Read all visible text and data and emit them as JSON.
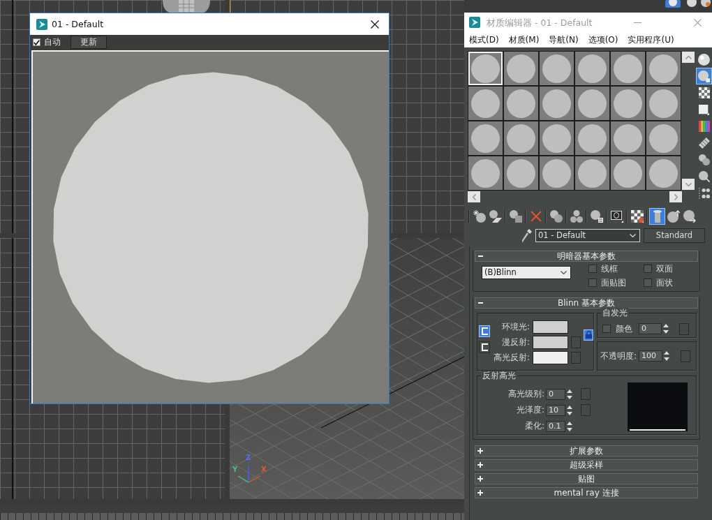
{
  "viewport": {
    "axis_labels": [
      {
        "text": "Z",
        "color": "#5a6cff"
      },
      {
        "text": "X",
        "color": "#e0582a"
      },
      {
        "text": "Y",
        "color": "#46c283"
      }
    ]
  },
  "preview_window": {
    "title": "01 - Default",
    "auto": {
      "label": "自动",
      "checked": true
    },
    "update_button": "更新"
  },
  "material_editor": {
    "title": "材质编辑器 - 01 - Default",
    "menu": [
      "模式(D)",
      "材质(M)",
      "导航(N)",
      "选项(O)",
      "实用程序(U)"
    ],
    "sample_slots": [
      {
        "selected": true
      },
      {
        "selected": false
      },
      {
        "selected": false
      },
      {
        "selected": false
      },
      {
        "selected": false
      },
      {
        "selected": false
      },
      {
        "selected": false
      },
      {
        "selected": false
      },
      {
        "selected": false
      },
      {
        "selected": false
      },
      {
        "selected": false
      },
      {
        "selected": false
      },
      {
        "selected": false
      },
      {
        "selected": false
      },
      {
        "selected": false
      },
      {
        "selected": false
      },
      {
        "selected": false
      },
      {
        "selected": false
      },
      {
        "selected": false
      },
      {
        "selected": false
      },
      {
        "selected": false
      },
      {
        "selected": false
      },
      {
        "selected": false
      },
      {
        "selected": false
      }
    ],
    "side_tools": [
      {
        "selected": false
      },
      {
        "selected": true
      },
      {
        "selected": false
      },
      {
        "selected": false
      },
      {
        "selected": false
      },
      {
        "selected": false
      },
      {
        "selected": false
      },
      {
        "selected": false
      },
      {
        "selected": false
      }
    ],
    "toolbar": [
      {
        "selected": false
      },
      {
        "selected": false
      },
      {
        "selected": false
      },
      {
        "selected": false
      },
      {
        "selected": false
      },
      {
        "selected": false
      },
      {
        "selected": false
      },
      {
        "selected": false
      },
      {
        "selected": false
      },
      {
        "selected": true
      },
      {
        "selected": false
      },
      {
        "selected": false
      }
    ],
    "material_name": "01 - Default",
    "material_type": "Standard",
    "rollouts": [
      {
        "kind": "shader",
        "title": "明暗器基本参数",
        "expanded": true,
        "shader": "(B)Blinn",
        "options": [
          {
            "label": "线框",
            "checked": false
          },
          {
            "label": "双面",
            "checked": false
          },
          {
            "label": "面贴图",
            "checked": false
          },
          {
            "label": "面状",
            "checked": false
          }
        ]
      },
      {
        "kind": "basic",
        "title": "Blinn 基本参数",
        "expanded": true,
        "color_locks": [
          {
            "selected": true
          },
          {
            "selected": false
          }
        ],
        "ambient_diffuse_lock": {
          "on": true
        },
        "colors": [
          {
            "label": "环境光:",
            "color": "#cfcfcf",
            "map": false
          },
          {
            "label": "漫反射:",
            "color": "#cfcfcf",
            "map": true
          },
          {
            "label": "高光反射:",
            "color": "#f0f0f0",
            "map": true
          }
        ],
        "self_illumination": {
          "title": "自发光",
          "checkbox": {
            "label": "颜色",
            "checked": false
          },
          "value": "0"
        },
        "opacity": {
          "label": "不透明度:",
          "value": "100"
        },
        "specular": {
          "title": "反射高光",
          "fields": [
            {
              "label": "高光级别:",
              "value": "0",
              "map": true
            },
            {
              "label": "光泽度:",
              "value": "10",
              "map": true
            },
            {
              "label": "柔化:",
              "value": "0.1",
              "map": false
            }
          ]
        }
      },
      {
        "title": "扩展参数",
        "expanded": false
      },
      {
        "title": "超级采样",
        "expanded": false
      },
      {
        "title": "贴图",
        "expanded": false
      },
      {
        "title": "mental ray 连接",
        "expanded": false
      }
    ]
  }
}
